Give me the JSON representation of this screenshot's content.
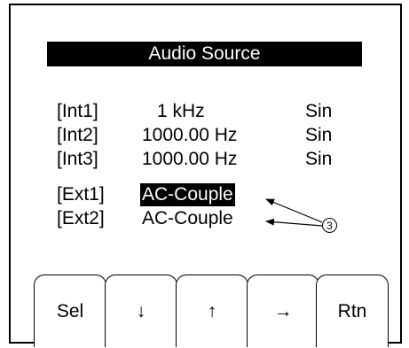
{
  "screen": {
    "title": "Audio Source"
  },
  "sources": [
    {
      "label": "[Int1]",
      "value": "1 kHz",
      "wave": "Sin"
    },
    {
      "label": "[Int2]",
      "value": "1000.00 Hz",
      "wave": "Sin"
    },
    {
      "label": "[Int3]",
      "value": "1000.00 Hz",
      "wave": "Sin"
    },
    {
      "label": "[Ext1]",
      "value": "AC-Couple",
      "wave": ""
    },
    {
      "label": "[Ext2]",
      "value": "AC-Couple",
      "wave": ""
    }
  ],
  "selected_source": "[Ext1]",
  "callout": {
    "number": "3"
  },
  "soft_keys": [
    {
      "label": "Sel",
      "icon": "select"
    },
    {
      "label": "↓",
      "icon": "arrow-down-icon"
    },
    {
      "label": "↑",
      "icon": "arrow-up-icon"
    },
    {
      "label": "→",
      "icon": "arrow-right-icon"
    },
    {
      "label": "Rtn",
      "icon": "return"
    }
  ]
}
